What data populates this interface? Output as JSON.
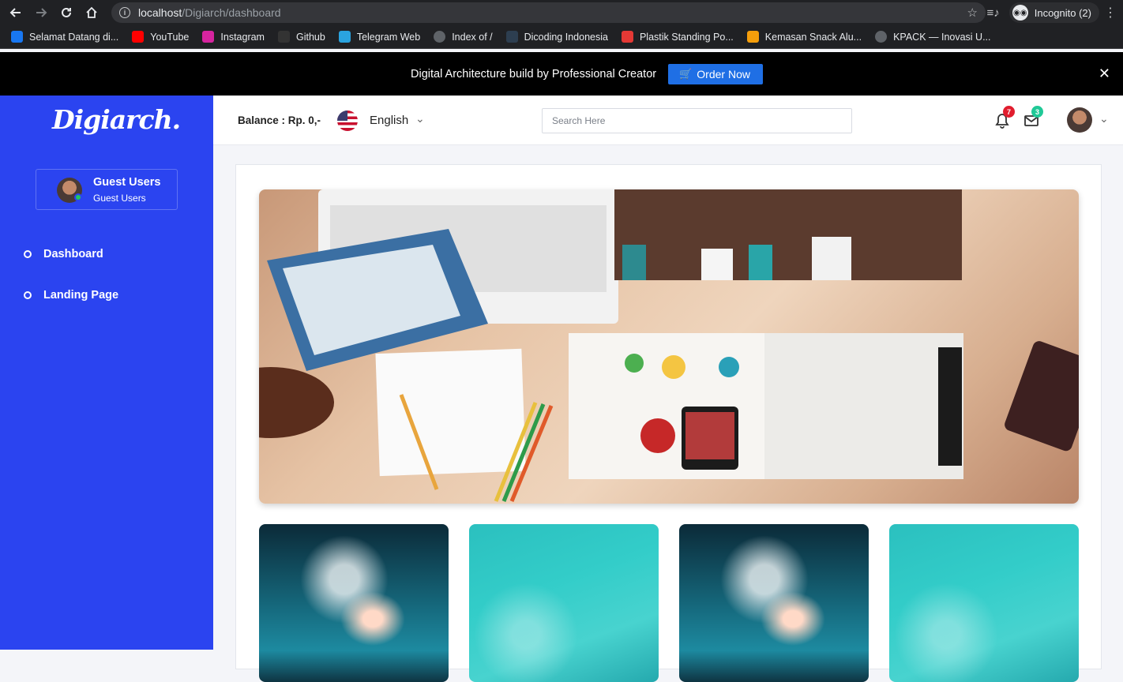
{
  "browser": {
    "url_host": "localhost",
    "url_path": "/Digiarch/dashboard",
    "incognito_label": "Incognito (2)",
    "bookmarks": [
      {
        "label": "Selamat Datang di...",
        "icon": "facebook-icon",
        "color": "#1877f2"
      },
      {
        "label": "YouTube",
        "icon": "youtube-icon",
        "color": "#ff0000"
      },
      {
        "label": "Instagram",
        "icon": "instagram-icon",
        "color": "#d6249f"
      },
      {
        "label": "Github",
        "icon": "github-icon",
        "color": "#333333"
      },
      {
        "label": "Telegram Web",
        "icon": "telegram-icon",
        "color": "#2aa3df"
      },
      {
        "label": "Index of /",
        "icon": "globe-icon",
        "color": "#5f6368"
      },
      {
        "label": "Dicoding Indonesia",
        "icon": "dicoding-icon",
        "color": "#2d3e50"
      },
      {
        "label": "Plastik Standing Po...",
        "icon": "plastik-icon",
        "color": "#e53935"
      },
      {
        "label": "Kemasan Snack Alu...",
        "icon": "kemasan-icon",
        "color": "#f59e0b"
      },
      {
        "label": "KPACK — Inovasi U...",
        "icon": "globe-icon",
        "color": "#5f6368"
      }
    ]
  },
  "promo": {
    "text": "Digital Architecture build by Professional Creator",
    "button_label": "Order Now"
  },
  "sidebar": {
    "logo": "Digiarch.",
    "user_name": "Guest Users",
    "user_role": "Guest Users",
    "items": [
      {
        "label": "Dashboard"
      },
      {
        "label": "Landing Page"
      }
    ]
  },
  "header": {
    "balance": "Balance : Rp. 0,-",
    "language": "English",
    "search_placeholder": "Search Here",
    "notifications_count": "7",
    "messages_count": "3"
  },
  "colors": {
    "sidebar": "#2b44f0",
    "order_button": "#1f6fe5",
    "notification_badge": "#e11d2e",
    "message_badge": "#20c997"
  }
}
